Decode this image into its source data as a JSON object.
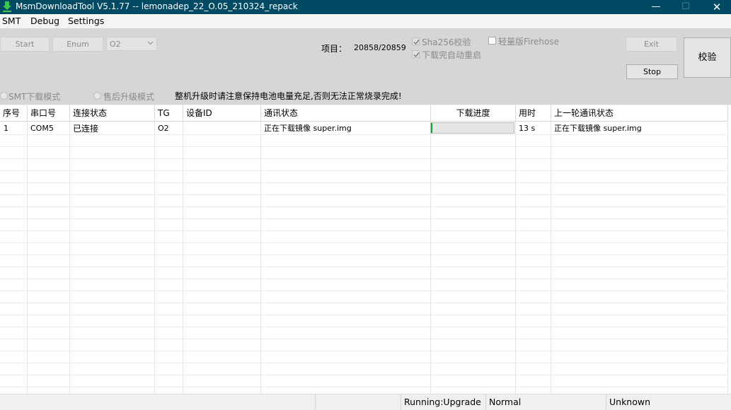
{
  "window": {
    "title": "MsmDownloadTool V5.1.77 -- lemonadep_22_O.05_210324_repack",
    "title_bar_color": "#004a63",
    "app_icon": "download-arrow-icon",
    "controls": {
      "minimize": "—",
      "maximize": "☐",
      "close": "✕"
    }
  },
  "menu": [
    "SMT",
    "Debug",
    "Settings"
  ],
  "toolbar": {
    "start_label": "Start",
    "enum_label": "Enum",
    "target_select": "O2",
    "project_label": "项目：",
    "project_value": "20858/20859",
    "sha256_label": "Sha256校验",
    "sha256_checked": true,
    "auto_reboot_label": "下载完自动重启",
    "auto_reboot_checked": true,
    "lite_firehose_label": "轻量版Firehose",
    "lite_firehose_checked": false,
    "exit_label": "Exit",
    "stop_label": "Stop",
    "verify_label": "校验",
    "smt_mode_label": "SMT下载模式",
    "after_sales_mode_label": "售后升级模式",
    "warning": "整机升级时请注意保持电池电量充足,否则无法正常烧录完成!"
  },
  "table": {
    "columns": [
      "序号",
      "串口号",
      "连接状态",
      "TG",
      "设备ID",
      "通讯状态",
      "下载进度",
      "用时",
      "上一轮通讯状态"
    ],
    "rows": [
      {
        "index": "1",
        "port": "COM5",
        "connection": "已连接",
        "tg": "O2",
        "device_id": "",
        "comm_status": "正在下载镜像 super.img",
        "progress": 0.02,
        "elapsed": "13 s",
        "prev_status": "正在下载镜像 super.img"
      }
    ],
    "progress_color": "#06b025"
  },
  "statusbar": {
    "segment1": "",
    "running": "Running:Upgrade",
    "mode": "Normal",
    "state": "Unknown"
  }
}
